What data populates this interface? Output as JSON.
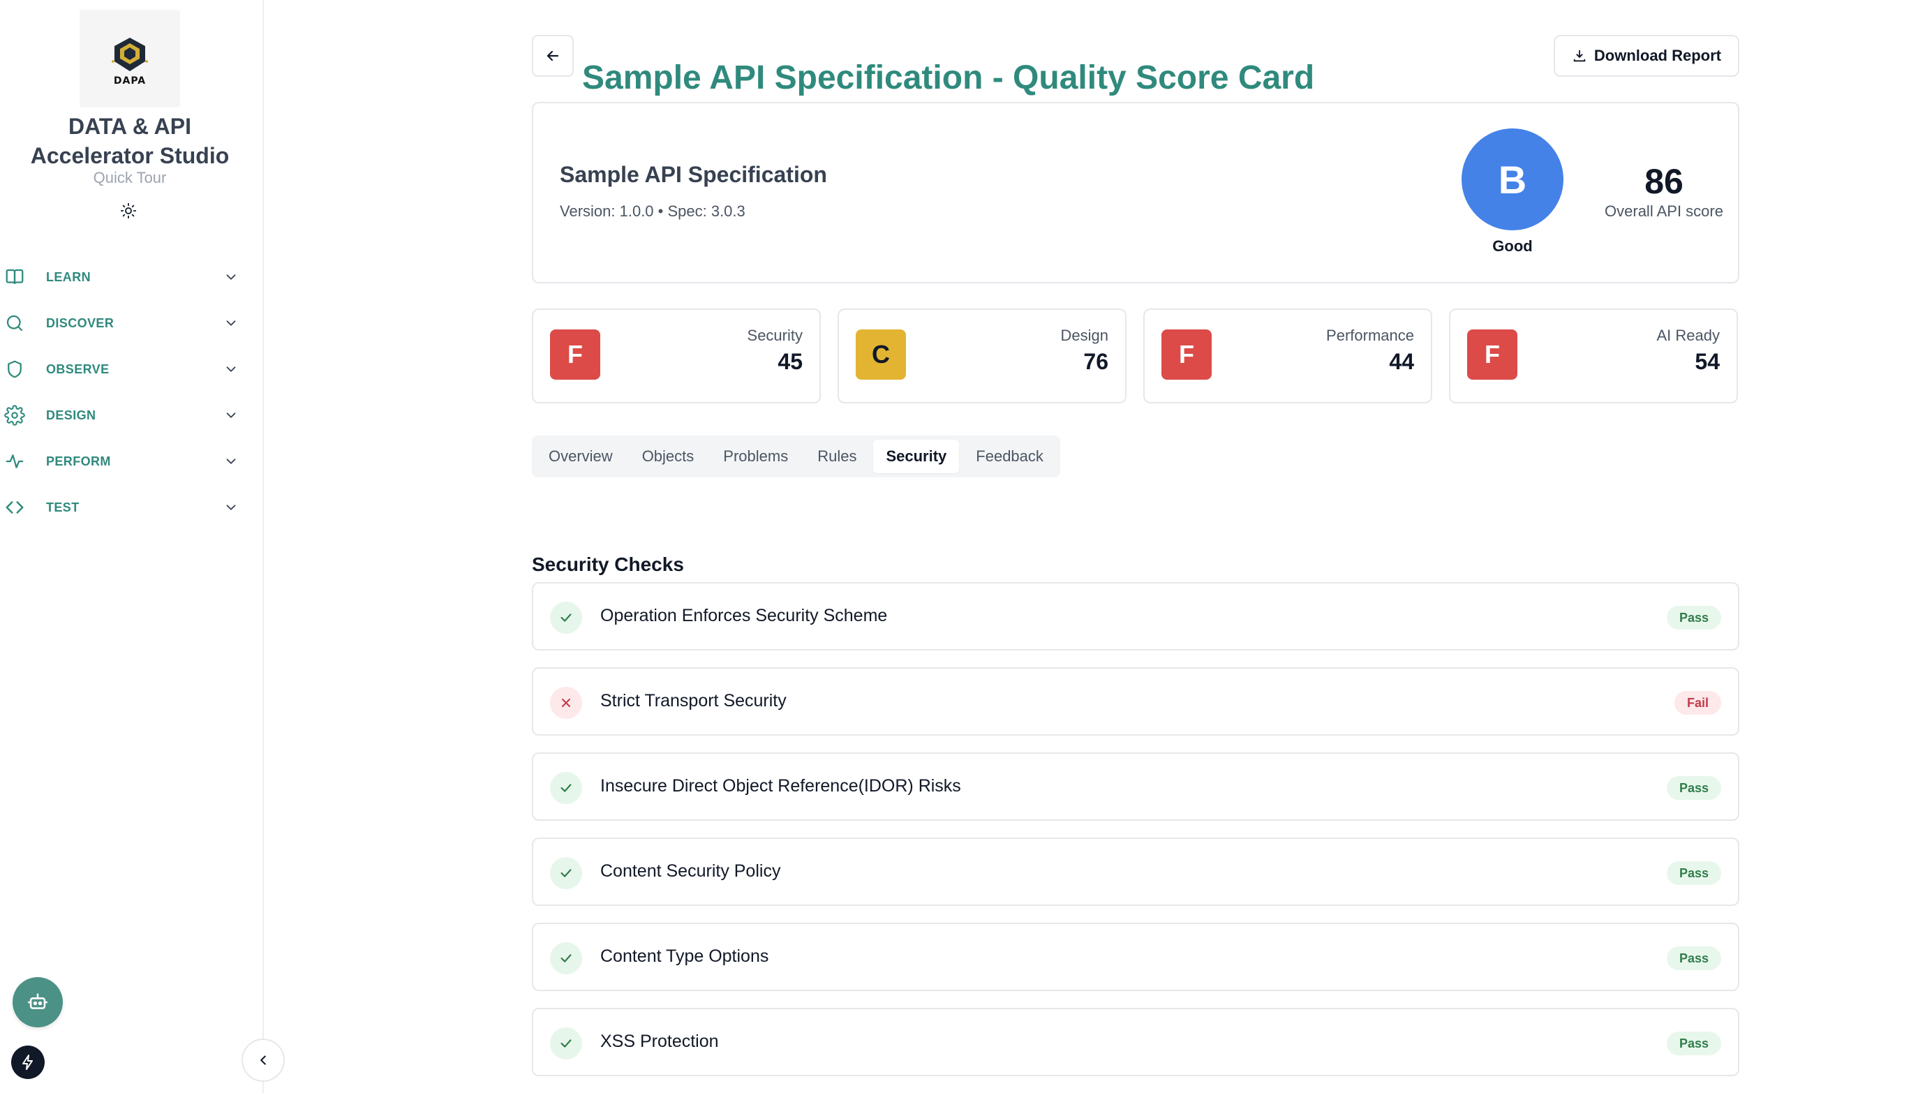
{
  "sidebar": {
    "logo_text": "DAPA",
    "brand_title": "DATA & API\nAccelerator Studio",
    "quick_tour": "Quick Tour",
    "theme_icon": "sun-icon",
    "items": [
      {
        "label": "LEARN",
        "icon": "book-icon"
      },
      {
        "label": "DISCOVER",
        "icon": "search-icon"
      },
      {
        "label": "OBSERVE",
        "icon": "shield-icon"
      },
      {
        "label": "DESIGN",
        "icon": "gear-icon"
      },
      {
        "label": "PERFORM",
        "icon": "activity-icon"
      },
      {
        "label": "TEST",
        "icon": "code-icon"
      }
    ]
  },
  "header": {
    "title": "Sample API Specification - Quality Score Card",
    "download_label": "Download Report",
    "back_icon": "arrow-left-icon",
    "download_icon": "download-icon"
  },
  "summary": {
    "api_name": "Sample API Specification",
    "meta": "Version: 1.0.0 • Spec: 3.0.3",
    "grade": "B",
    "grade_label": "Good",
    "overall_score": "86",
    "overall_label": "Overall API score"
  },
  "score_cards": [
    {
      "grade": "F",
      "title": "Security",
      "value": "45"
    },
    {
      "grade": "C",
      "title": "Design",
      "value": "76"
    },
    {
      "grade": "F",
      "title": "Performance",
      "value": "44"
    },
    {
      "grade": "F",
      "title": "AI Ready",
      "value": "54"
    }
  ],
  "tabs": [
    "Overview",
    "Objects",
    "Problems",
    "Rules",
    "Security",
    "Feedback"
  ],
  "active_tab": "Security",
  "section": {
    "title": "Security Checks"
  },
  "checks": [
    {
      "name": "Operation Enforces Security Scheme",
      "status": "Pass"
    },
    {
      "name": "Strict Transport Security",
      "status": "Fail"
    },
    {
      "name": "Insecure Direct Object Reference(IDOR) Risks",
      "status": "Pass"
    },
    {
      "name": "Content Security Policy",
      "status": "Pass"
    },
    {
      "name": "Content Type Options",
      "status": "Pass"
    },
    {
      "name": "XSS Protection",
      "status": "Pass"
    }
  ],
  "colors": {
    "accent": "#2f8a7d",
    "grade_b": "#4482e8",
    "grade_f": "#dc4b48",
    "grade_c": "#e2b432"
  }
}
